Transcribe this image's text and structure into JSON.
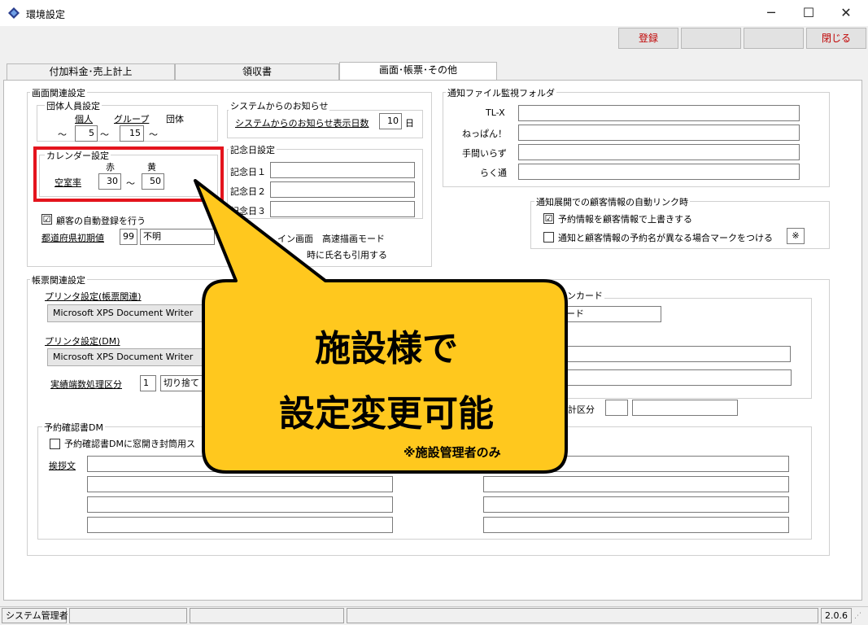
{
  "window": {
    "title": "環境設定",
    "minimize_glyph": "─",
    "maximize_glyph": "☐",
    "close_glyph": "✕",
    "icon": "app-diamond-icon"
  },
  "toolbar": {
    "register_label": "登録",
    "blank1_label": "",
    "blank2_label": "",
    "close_label": "閉じる"
  },
  "tabs": [
    {
      "label": "付加料金･売上計上"
    },
    {
      "label": "領収書"
    },
    {
      "label": "画面･帳票･その他"
    }
  ],
  "screen": {
    "title": "画面関連設定",
    "group_size": {
      "title": "団体人員設定",
      "col_individual": "個人",
      "col_group": "グループ",
      "col_team": "団体",
      "tilde": "～",
      "value_individual": "5",
      "value_group": "15"
    },
    "calendar": {
      "title": "カレンダー設定",
      "col_red": "赤",
      "col_yellow": "黄",
      "row_label": "空室率",
      "value_red": "30",
      "value_yellow": "50",
      "tilde": "～"
    },
    "auto_register": {
      "label": "顧客の自動登録を行う",
      "checked": "☑"
    },
    "prefecture": {
      "label": "都道府県初期値",
      "code": "99",
      "name": "不明"
    },
    "system_notice": {
      "title": "システムからのお知らせ",
      "label": "システムからのお知らせ表示日数",
      "value": "10",
      "unit": "日"
    },
    "anniversary": {
      "title": "記念日設定",
      "items": [
        {
          "label": "記念日１",
          "value": ""
        },
        {
          "label": "記念日２",
          "value": ""
        },
        {
          "label": "記念日３",
          "value": ""
        }
      ]
    },
    "partial": {
      "mode_a": "イン画面",
      "mode_b": "高速描画モード",
      "cite_name": "時に氏名も引用する"
    }
  },
  "notify": {
    "folder_title": "通知ファイル監視フォルダ",
    "items": [
      {
        "label": "TL-X",
        "value": ""
      },
      {
        "label": "ねっぱん！",
        "value": ""
      },
      {
        "label": "手間いらず",
        "value": ""
      },
      {
        "label": "らく通",
        "value": ""
      }
    ],
    "autolink": {
      "title": "通知展開での顧客情報の自動リンク時",
      "overwrite": {
        "label": "予約情報を顧客情報で上書きする",
        "checked": "☑"
      },
      "mark": {
        "label": "通知と顧客情報の予約名が異なる場合マークをつける",
        "checked": "",
        "value": "※"
      }
    }
  },
  "forms": {
    "title": "帳票関連設定",
    "printer_forms": {
      "label": "プリンタ設定(帳票関連)",
      "value": "Microsoft XPS Document Writer"
    },
    "printer_dm": {
      "label": "プリンタ設定(DM)",
      "value": "Microsoft XPS Document Writer"
    },
    "rounding": {
      "label": "実績端数処理区分",
      "code": "1",
      "name": "切り捨て"
    },
    "checkin_partial": "インカード",
    "card_partial": "ード",
    "aggregate_partial": "計区分",
    "reservation_dm": {
      "title": "予約確認書DM",
      "checkbox_label": "予約確認書DMに窓開き封筒用ス",
      "greeting_label": "挨拶文"
    }
  },
  "callout": {
    "line1": "施設様で",
    "line2": "設定変更可能",
    "note": "※施設管理者のみ",
    "fill": "#ffc81e"
  },
  "status": {
    "user": "システム管理者",
    "version": "2.0.6"
  }
}
